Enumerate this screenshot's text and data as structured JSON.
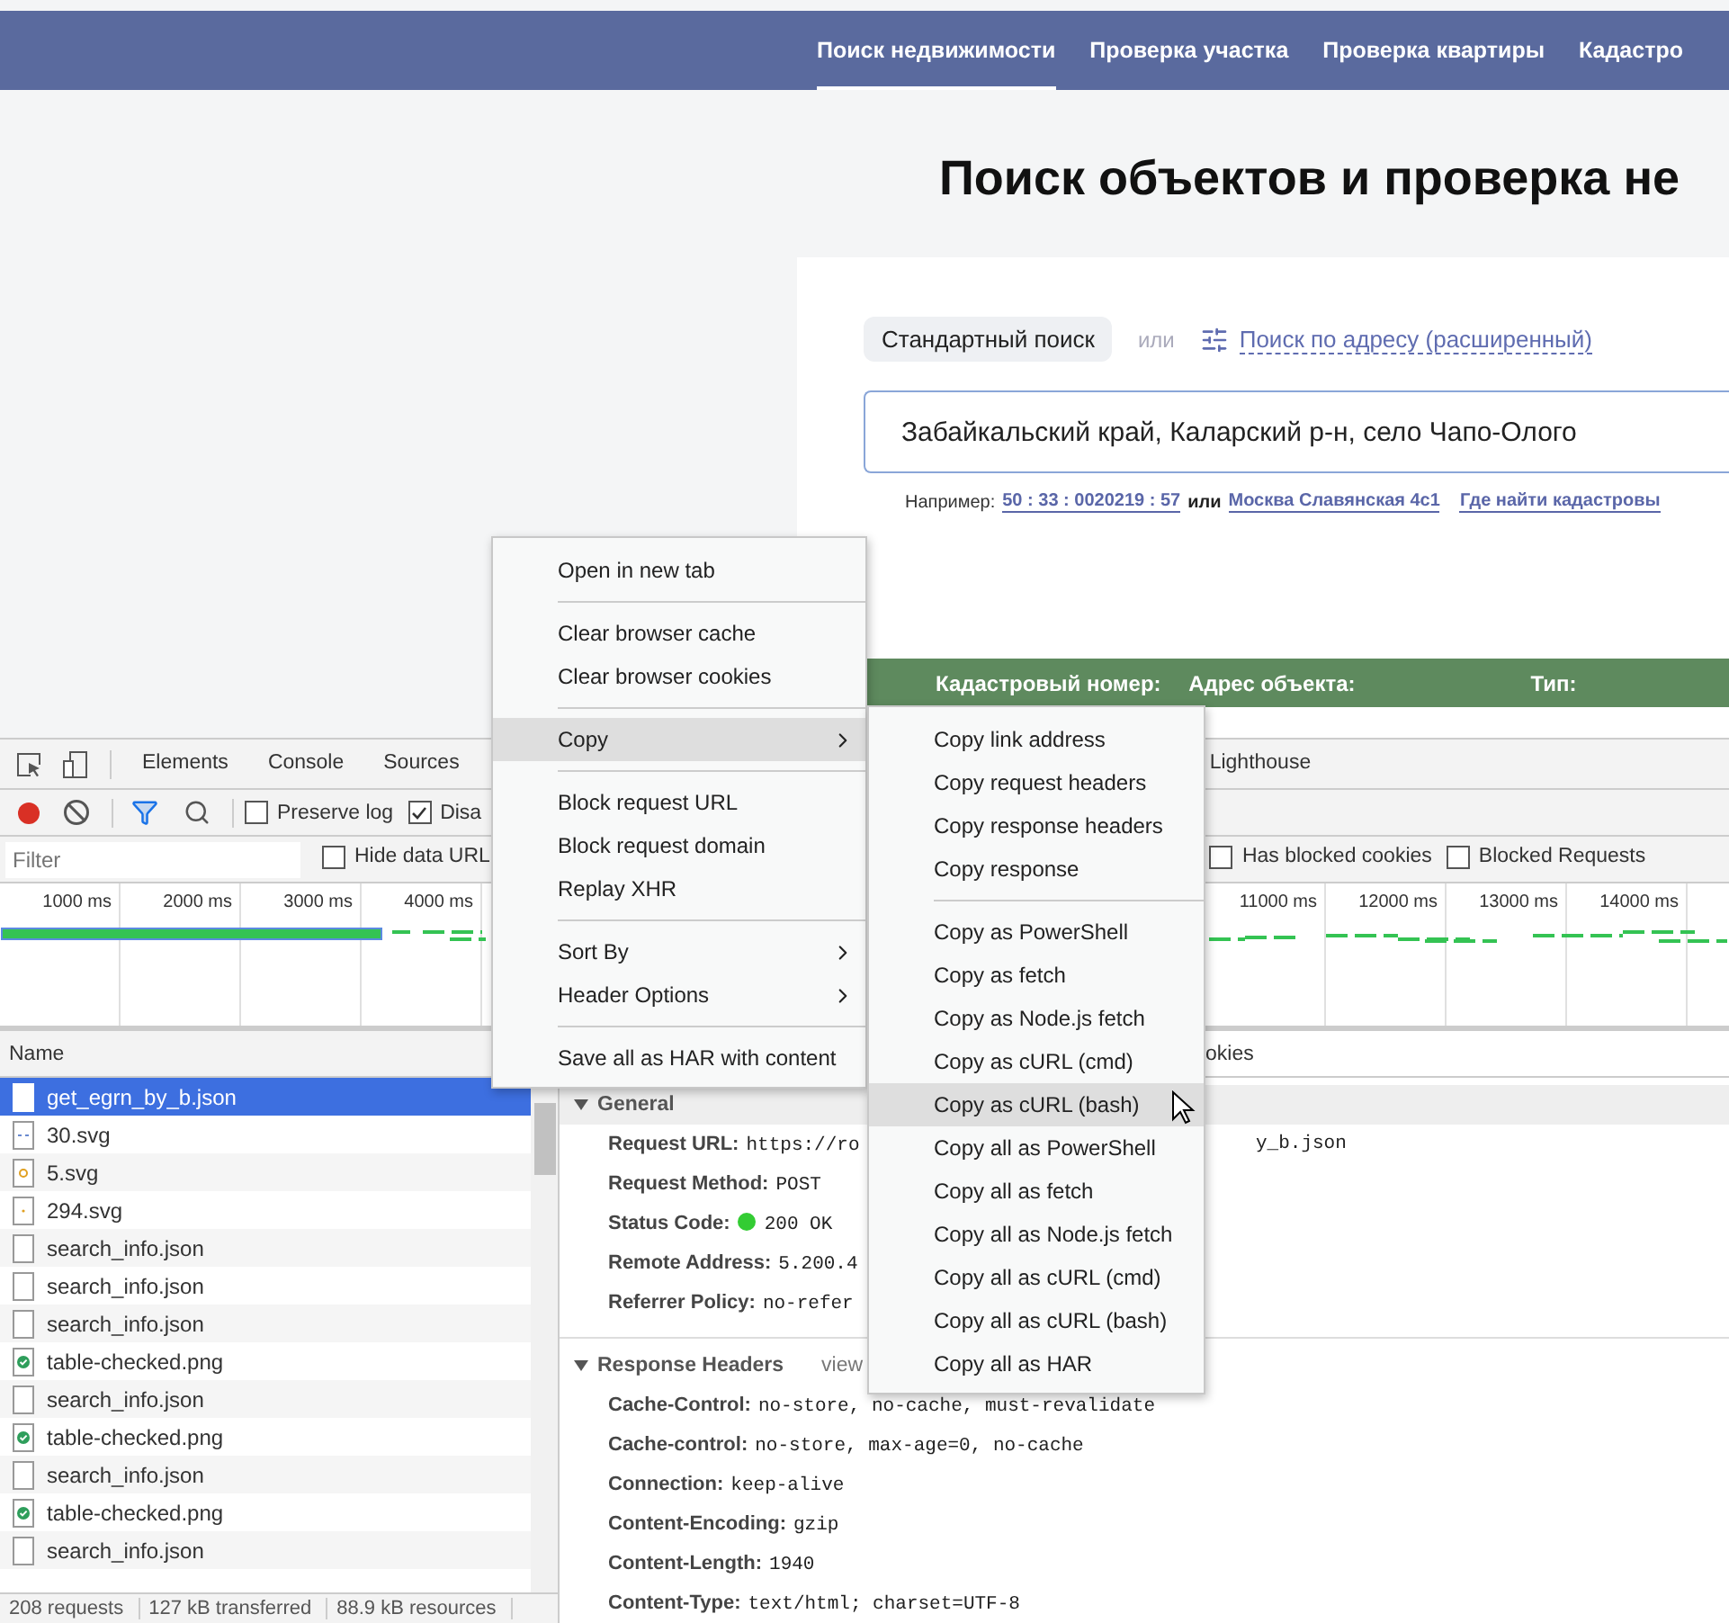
{
  "site": {
    "nav": [
      {
        "label": "Поиск недвижимости",
        "selected": true
      },
      {
        "label": "Проверка участка",
        "selected": false
      },
      {
        "label": "Проверка квартиры",
        "selected": false
      },
      {
        "label": "Кадастро",
        "selected": false
      }
    ],
    "title": "Поиск объектов и проверка не",
    "search_modes": {
      "standard": "Стандартный поиск",
      "separator": "или",
      "advanced": "Поиск по адресу (расширенный)"
    },
    "search": {
      "value": "Забайкальский край, Каларский р-н, село Чапо-Олого"
    },
    "examples": {
      "prefix": "Например:",
      "first": "50 : 33 : 0020219 : 57",
      "joiner": "или",
      "second": "Москва Славянская 4с1",
      "help_link": "Где найти кадастровы"
    },
    "results_table": {
      "columns": [
        "Кадастровый номер:",
        "Адрес объекта:",
        "Тип:"
      ]
    }
  },
  "devtools": {
    "tabs": [
      {
        "label": "Elements",
        "selected": false
      },
      {
        "label": "Console",
        "selected": false
      },
      {
        "label": "Sources",
        "selected": false
      },
      {
        "label": "Lighthouse",
        "selected": false
      }
    ],
    "toolbar": {
      "recording": true,
      "checkboxes": [
        {
          "label": "Preserve log",
          "checked": false
        },
        {
          "label": "Disa",
          "checked": true
        }
      ]
    },
    "filter": {
      "placeholder": "Filter",
      "checkboxes": [
        {
          "label": "Hide data URL",
          "checked": false
        },
        {
          "label": "Has blocked cookies",
          "checked": false
        },
        {
          "label": "Blocked Requests",
          "checked": false
        }
      ]
    },
    "timeline": {
      "ticks_left": [
        "1000 ms",
        "2000 ms",
        "3000 ms",
        "4000 ms"
      ],
      "ticks_right": [
        "11000 ms",
        "12000 ms",
        "13000 ms",
        "14000 ms"
      ]
    },
    "requests": {
      "header": "Name",
      "rows": [
        {
          "name": "get_egrn_by_b.json",
          "kind": "blank",
          "selected": true
        },
        {
          "name": "30.svg",
          "kind": "dashes",
          "selected": false
        },
        {
          "name": "5.svg",
          "kind": "sun",
          "selected": false
        },
        {
          "name": "294.svg",
          "kind": "dot",
          "selected": false
        },
        {
          "name": "search_info.json",
          "kind": "blank",
          "selected": false
        },
        {
          "name": "search_info.json",
          "kind": "blank",
          "selected": false
        },
        {
          "name": "search_info.json",
          "kind": "blank",
          "selected": false
        },
        {
          "name": "table-checked.png",
          "kind": "checked",
          "selected": false
        },
        {
          "name": "search_info.json",
          "kind": "blank",
          "selected": false
        },
        {
          "name": "table-checked.png",
          "kind": "checked",
          "selected": false
        },
        {
          "name": "search_info.json",
          "kind": "blank",
          "selected": false
        },
        {
          "name": "table-checked.png",
          "kind": "checked",
          "selected": false
        },
        {
          "name": "search_info.json",
          "kind": "blank",
          "selected": false
        }
      ]
    },
    "status_bar": [
      "208 requests",
      "127 kB transferred",
      "88.9 kB resources"
    ],
    "details": {
      "tab_fragment": "okies",
      "sections": [
        {
          "title": "General",
          "expanded": true,
          "rows": [
            {
              "label": "Request URL:",
              "value": "https://ro",
              "value_tail": "y_b.json"
            },
            {
              "label": "Request Method:",
              "value": "POST"
            },
            {
              "label": "Status Code:",
              "value": "200 OK",
              "kind": "status"
            },
            {
              "label": "Remote Address:",
              "value": "5.200.4"
            },
            {
              "label": "Referrer Policy:",
              "value": "no-refer"
            }
          ]
        },
        {
          "title": "Response Headers",
          "expanded": true,
          "link": "view",
          "rows": [
            {
              "label": "Cache-Control:",
              "value": "no-store, no-cache, must-revalidate"
            },
            {
              "label": "Cache-control:",
              "value": "no-store, max-age=0, no-cache"
            },
            {
              "label": "Connection:",
              "value": "keep-alive"
            },
            {
              "label": "Content-Encoding:",
              "value": "gzip"
            },
            {
              "label": "Content-Length:",
              "value": "1940"
            },
            {
              "label": "Content-Type:",
              "value": "text/html; charset=UTF-8"
            }
          ]
        }
      ]
    }
  },
  "context_menu": {
    "items": [
      {
        "kind": "item",
        "label": "Open in new tab",
        "submenu": false,
        "highlighted": false
      },
      {
        "kind": "separator"
      },
      {
        "kind": "item",
        "label": "Clear browser cache",
        "submenu": false,
        "highlighted": false
      },
      {
        "kind": "item",
        "label": "Clear browser cookies",
        "submenu": false,
        "highlighted": false
      },
      {
        "kind": "separator"
      },
      {
        "kind": "item",
        "label": "Copy",
        "submenu": true,
        "highlighted": true
      },
      {
        "kind": "separator"
      },
      {
        "kind": "item",
        "label": "Block request URL",
        "submenu": false,
        "highlighted": false
      },
      {
        "kind": "item",
        "label": "Block request domain",
        "submenu": false,
        "highlighted": false
      },
      {
        "kind": "item",
        "label": "Replay XHR",
        "submenu": false,
        "highlighted": false
      },
      {
        "kind": "separator"
      },
      {
        "kind": "item",
        "label": "Sort By",
        "submenu": true,
        "highlighted": false
      },
      {
        "kind": "item",
        "label": "Header Options",
        "submenu": true,
        "highlighted": false
      },
      {
        "kind": "separator"
      },
      {
        "kind": "item",
        "label": "Save all as HAR with content",
        "submenu": false,
        "highlighted": false
      }
    ]
  },
  "copy_submenu": {
    "items": [
      {
        "kind": "item",
        "label": "Copy link address",
        "highlighted": false
      },
      {
        "kind": "item",
        "label": "Copy request headers",
        "highlighted": false
      },
      {
        "kind": "item",
        "label": "Copy response headers",
        "highlighted": false
      },
      {
        "kind": "item",
        "label": "Copy response",
        "highlighted": false
      },
      {
        "kind": "separator"
      },
      {
        "kind": "item",
        "label": "Copy as PowerShell",
        "highlighted": false
      },
      {
        "kind": "item",
        "label": "Copy as fetch",
        "highlighted": false
      },
      {
        "kind": "item",
        "label": "Copy as Node.js fetch",
        "highlighted": false
      },
      {
        "kind": "item",
        "label": "Copy as cURL (cmd)",
        "highlighted": false
      },
      {
        "kind": "item",
        "label": "Copy as cURL (bash)",
        "highlighted": true
      },
      {
        "kind": "item",
        "label": "Copy all as PowerShell",
        "highlighted": false
      },
      {
        "kind": "item",
        "label": "Copy all as fetch",
        "highlighted": false
      },
      {
        "kind": "item",
        "label": "Copy all as Node.js fetch",
        "highlighted": false
      },
      {
        "kind": "item",
        "label": "Copy all as cURL (cmd)",
        "highlighted": false
      },
      {
        "kind": "item",
        "label": "Copy all as cURL (bash)",
        "highlighted": false
      },
      {
        "kind": "item",
        "label": "Copy all as HAR",
        "highlighted": false
      }
    ]
  }
}
